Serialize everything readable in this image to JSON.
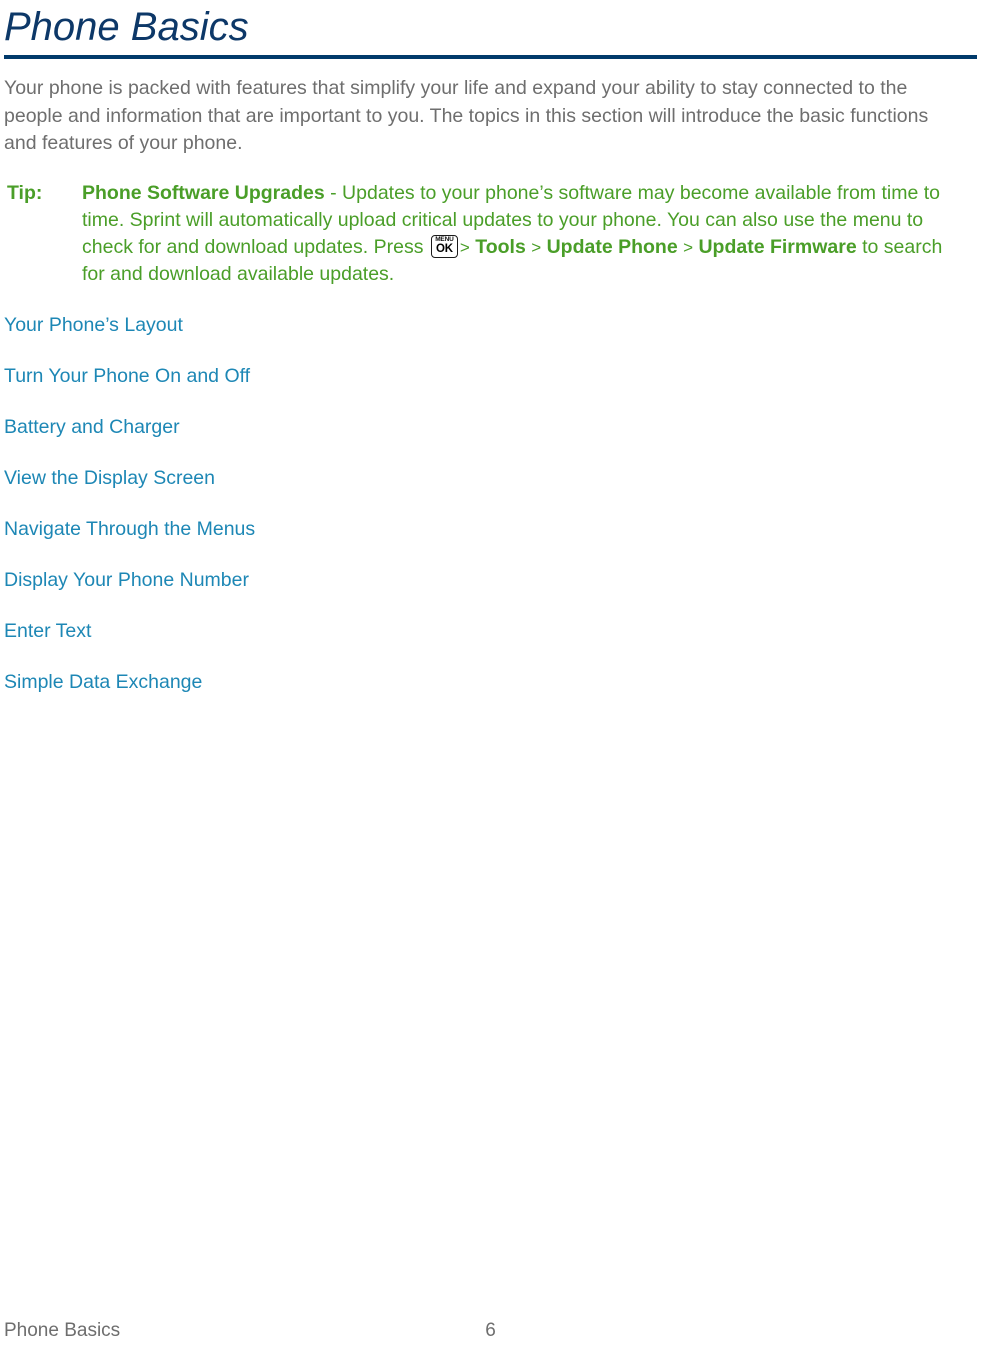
{
  "document": {
    "chapter_title": "Phone Basics",
    "intro_paragraph": "Your phone is packed with features that simplify your life and expand your ability to stay connected to the people and information that are important to you. The topics in this section will introduce the basic functions and features of your phone."
  },
  "tip": {
    "label": "Tip:",
    "heading": "Phone Software Upgrades",
    "text_part_1": " - Updates to your phone’s software may become available from time to time. Sprint will automatically upload critical updates to your phone. You can also use the menu to check for and download updates. Press ",
    "key_icon": {
      "name": "menu-ok-key-icon",
      "top_label": "MENU",
      "bottom_label": "OK"
    },
    "separator": ">",
    "menu_path": [
      "Tools",
      "Update Phone",
      "Update Firmware"
    ],
    "text_part_2": " to search for and download available updates."
  },
  "links": [
    {
      "label": "Your Phone’s Layout"
    },
    {
      "label": "Turn Your Phone On and Off"
    },
    {
      "label": "Battery and Charger"
    },
    {
      "label": "View the Display Screen"
    },
    {
      "label": "Navigate Through the Menus"
    },
    {
      "label": "Display Your Phone Number"
    },
    {
      "label": "Enter Text"
    },
    {
      "label": "Simple Data Exchange"
    }
  ],
  "footer": {
    "section_name": "Phone Basics",
    "page_number": "6"
  },
  "colors": {
    "title": "#0d3868",
    "rule": "#013a6b",
    "body_text": "#6e6e6e",
    "tip_green": "#4a9e28",
    "link_blue": "#1d87b5",
    "background": "#ffffff"
  }
}
